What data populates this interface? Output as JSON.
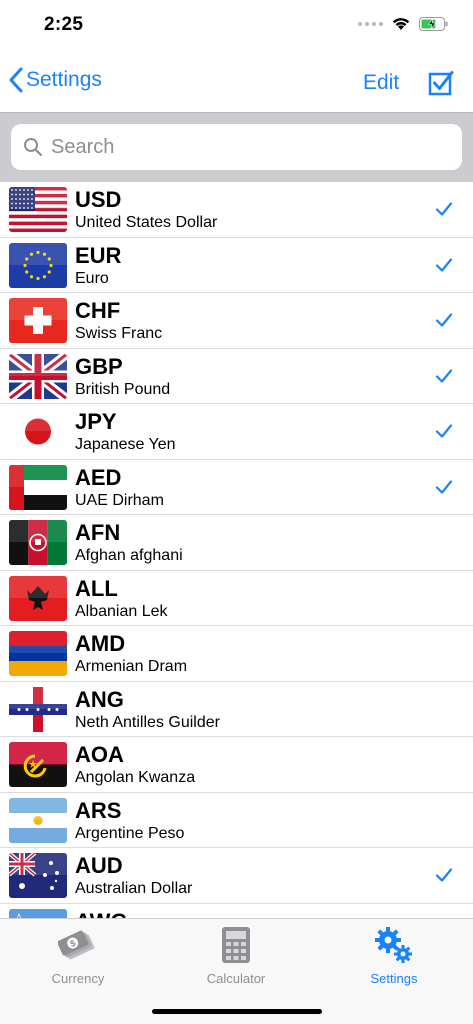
{
  "status": {
    "time": "2:25"
  },
  "nav": {
    "back_label": "Settings",
    "edit_label": "Edit"
  },
  "search": {
    "placeholder": "Search"
  },
  "currencies": [
    {
      "code": "USD",
      "name": "United States Dollar",
      "checked": true,
      "flag": "us"
    },
    {
      "code": "EUR",
      "name": "Euro",
      "checked": true,
      "flag": "eu"
    },
    {
      "code": "CHF",
      "name": "Swiss Franc",
      "checked": true,
      "flag": "ch"
    },
    {
      "code": "GBP",
      "name": "British Pound",
      "checked": true,
      "flag": "gb"
    },
    {
      "code": "JPY",
      "name": "Japanese Yen",
      "checked": true,
      "flag": "jp"
    },
    {
      "code": "AED",
      "name": "UAE Dirham",
      "checked": true,
      "flag": "ae"
    },
    {
      "code": "AFN",
      "name": "Afghan afghani",
      "checked": false,
      "flag": "af"
    },
    {
      "code": "ALL",
      "name": "Albanian Lek",
      "checked": false,
      "flag": "al"
    },
    {
      "code": "AMD",
      "name": "Armenian Dram",
      "checked": false,
      "flag": "am"
    },
    {
      "code": "ANG",
      "name": "Neth Antilles Guilder",
      "checked": false,
      "flag": "an"
    },
    {
      "code": "AOA",
      "name": "Angolan Kwanza",
      "checked": false,
      "flag": "ao"
    },
    {
      "code": "ARS",
      "name": "Argentine Peso",
      "checked": false,
      "flag": "ar"
    },
    {
      "code": "AUD",
      "name": "Australian Dollar",
      "checked": true,
      "flag": "au"
    },
    {
      "code": "AWG",
      "name": "",
      "checked": false,
      "flag": "aw"
    }
  ],
  "tabs": [
    {
      "label": "Currency",
      "icon": "money-icon",
      "active": false
    },
    {
      "label": "Calculator",
      "icon": "calculator-icon",
      "active": false
    },
    {
      "label": "Settings",
      "icon": "gears-icon",
      "active": true
    }
  ],
  "colors": {
    "accent": "#1a82fb",
    "inactive": "#8e8e93"
  }
}
